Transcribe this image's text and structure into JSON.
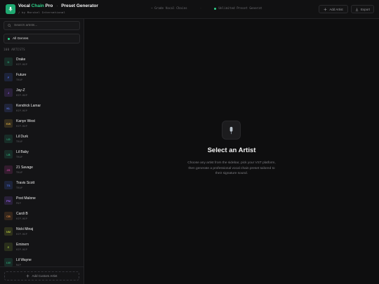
{
  "header": {
    "brand_prefix": "Vocal",
    "brand_accent": "Chain",
    "brand_suffix": "Pro",
    "brand_separator": "·",
    "brand_page": "Preset Generator",
    "byline": "/ by Marckel International",
    "badge1": "~ Grade Vocal Chains",
    "badge_sep": "·",
    "badge2": "Unlimited Preset Generat",
    "add_artist": "Add Artist",
    "export": "Export"
  },
  "sidebar": {
    "search_placeholder": "Search artists...",
    "genre_selected": "All Genres",
    "count_label": "100 ARTISTS",
    "add_custom": "Add Custom Artist",
    "artists": [
      {
        "initials": "D",
        "name": "Drake",
        "genre": "HIP-HOP",
        "color": "#2c9d72"
      },
      {
        "initials": "F",
        "name": "Future",
        "genre": "TRAP",
        "color": "#4a6ad8"
      },
      {
        "initials": "J",
        "name": "Jay-Z",
        "genre": "HIP-HOP",
        "color": "#8a58d8"
      },
      {
        "initials": "KL",
        "name": "Kendrick Lamar",
        "genre": "HIP-HOP",
        "color": "#5670d8"
      },
      {
        "initials": "KW",
        "name": "Kanye West",
        "genre": "HIP-HOP",
        "color": "#c9a040"
      },
      {
        "initials": "LD",
        "name": "Lil Durk",
        "genre": "TRAP",
        "color": "#2c9d72"
      },
      {
        "initials": "LB",
        "name": "Lil Baby",
        "genre": "TRAP",
        "color": "#2c9d72"
      },
      {
        "initials": "2S",
        "name": "21 Savage",
        "genre": "TRAP",
        "color": "#c0449a"
      },
      {
        "initials": "TS",
        "name": "Travis Scott",
        "genre": "TRAP",
        "color": "#4a6ad8"
      },
      {
        "initials": "PM",
        "name": "Post Malone",
        "genre": "POP",
        "color": "#8a58d8"
      },
      {
        "initials": "CB",
        "name": "Cardi B",
        "genre": "HIP-HOP",
        "color": "#c87a3a"
      },
      {
        "initials": "NM",
        "name": "Nicki Minaj",
        "genre": "HIP-HOP",
        "color": "#a8b83a"
      },
      {
        "initials": "E",
        "name": "Eminem",
        "genre": "HIP-HOP",
        "color": "#8aa83a"
      },
      {
        "initials": "LW",
        "name": "Lil Wayne",
        "genre": "RAP",
        "color": "#2c9d72"
      }
    ]
  },
  "main": {
    "title": "Select an Artist",
    "description": "Choose any artist from the sidebar, pick your VST platform, then generate a professional vocal chain preset tailored to their signature sound."
  },
  "colors": {
    "accent": "#2fd18a",
    "background": "#0e0e0f",
    "sidebar": "#141416"
  },
  "icons": {
    "logo": "mic-icon",
    "search": "search-icon",
    "add": "plus-icon",
    "export": "download-icon",
    "placeholder": "mic-icon"
  }
}
